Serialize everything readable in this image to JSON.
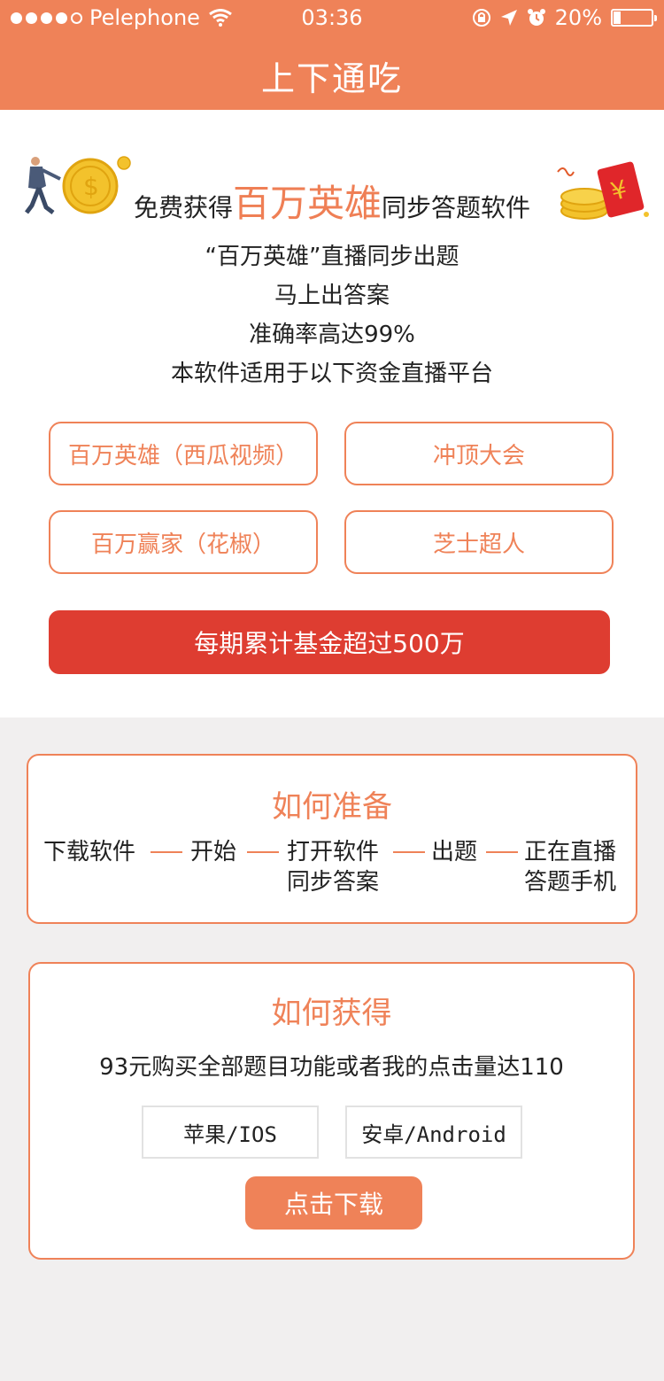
{
  "status_bar": {
    "carrier": "Pelephone",
    "time": "03:36",
    "battery": "20%",
    "battery_level": 0.2
  },
  "header": {
    "title": "上下通吃"
  },
  "hero": {
    "headline_prefix": "免费获得",
    "headline_highlight": "百万英雄",
    "headline_suffix": "同步答题软件",
    "lines": [
      "“百万英雄”直播同步出题",
      "马上出答案",
      "准确率高达99%",
      "本软件适用于以下资金直播平台"
    ],
    "platforms": [
      "百万英雄（西瓜视频）",
      "冲顶大会",
      "百万赢家（花椒）",
      "芝士超人"
    ],
    "fund_label": "每期累计基金超过500万",
    "colors": {
      "accent": "#ef8258",
      "fund_red": "#de3d31"
    }
  },
  "prepare": {
    "title": "如何准备",
    "steps": [
      "下载软件",
      "开始",
      "打开软件",
      "同步答案",
      "出题",
      "正在直播",
      "答题手机"
    ]
  },
  "obtain": {
    "title": "如何获得",
    "promo": "93元购买全部题目功能或者我的点击量达110",
    "ios_label": "苹果/IOS",
    "android_label": "安卓/Android",
    "download_label": "点击下载"
  },
  "icons": [
    "signal-dots-icon",
    "wifi-icon",
    "lock-rotation-icon",
    "location-arrow-icon",
    "alarm-icon",
    "battery-icon",
    "businessman-coin-illustration",
    "red-envelope-coins-illustration"
  ]
}
